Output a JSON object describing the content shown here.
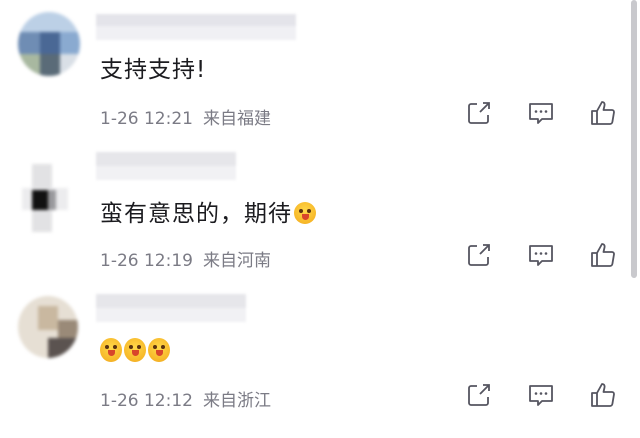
{
  "comments": [
    {
      "text": "支持支持!",
      "time": "1-26 12:21",
      "location": "来自福建"
    },
    {
      "text": "蛮有意思的，期待",
      "time": "1-26 12:19",
      "location": "来自河南"
    },
    {
      "text": "",
      "time": "1-26 12:12",
      "location": "来自浙江"
    }
  ],
  "icons": {
    "share": "share-icon",
    "reply": "comment-icon",
    "like": "thumbs-up-icon",
    "emoji": "face-emoji-icon"
  },
  "colors": {
    "text": "#1b1b1f",
    "meta": "#7b7b85",
    "icon": "#555560"
  }
}
